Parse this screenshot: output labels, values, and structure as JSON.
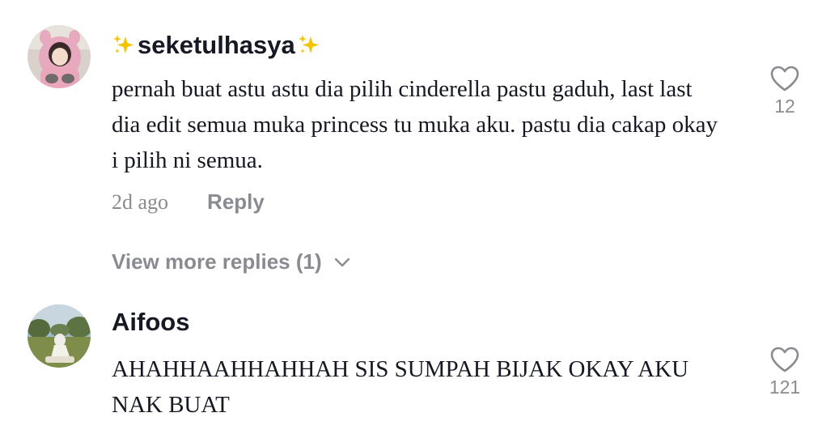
{
  "comments": [
    {
      "username": "seketulhasya",
      "text": "pernah buat astu astu dia pilih cinderella pastu gaduh, last last dia edit semua muka princess tu muka aku. pastu dia cakap okay i pilih ni semua.",
      "time": "2d ago",
      "reply_label": "Reply",
      "like_count": "12",
      "view_more_label": "View more replies (1)"
    },
    {
      "username": "Aifoos",
      "text": "AHAHHAAHHAHHAH SIS SUMPAH BIJAK OKAY AKU NAK BUAT",
      "like_count": "121"
    }
  ],
  "icons": {
    "username_decoration": "sparkles-icon",
    "like": "heart-outline-icon",
    "expand": "chevron-down-icon"
  },
  "colors": {
    "text_primary": "#161823",
    "text_secondary": "#8a8b91",
    "sparkle": "#f5c400"
  }
}
